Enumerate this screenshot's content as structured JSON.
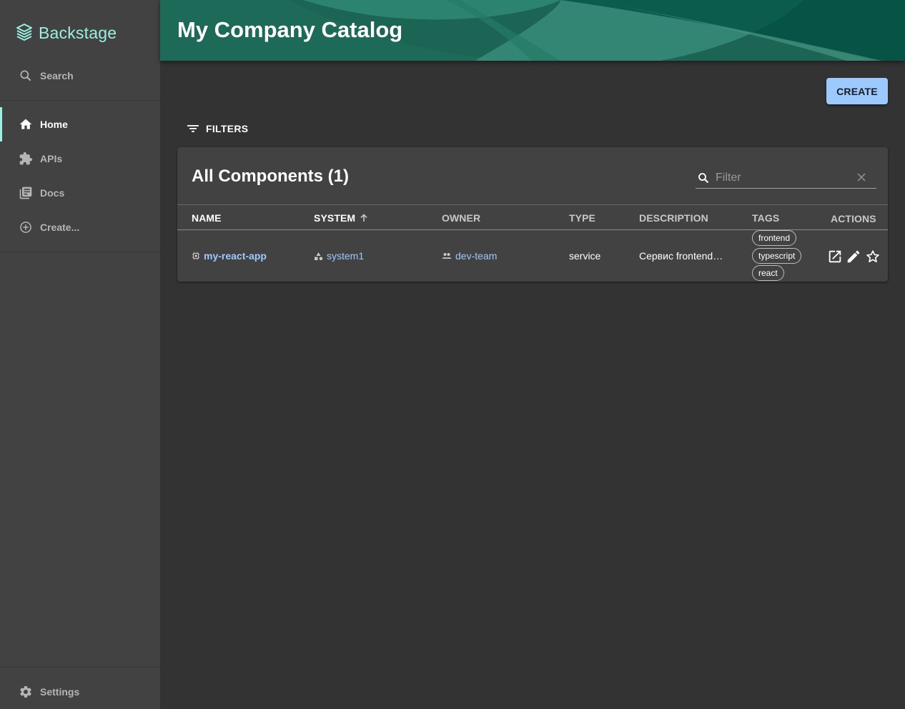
{
  "sidebar": {
    "logo_text": "Backstage",
    "search_label": "Search",
    "items": [
      {
        "label": "Home",
        "icon": "home-icon",
        "active": true
      },
      {
        "label": "APIs",
        "icon": "puzzle-icon",
        "active": false
      },
      {
        "label": "Docs",
        "icon": "docs-icon",
        "active": false
      },
      {
        "label": "Create...",
        "icon": "add-circle-icon",
        "active": false
      }
    ],
    "settings_label": "Settings"
  },
  "header": {
    "title": "My Company Catalog"
  },
  "toolbar": {
    "create_label": "CREATE",
    "filters_label": "FILTERS"
  },
  "table": {
    "title": "All Components (1)",
    "search_placeholder": "Filter",
    "columns": [
      "NAME",
      "SYSTEM",
      "OWNER",
      "TYPE",
      "DESCRIPTION",
      "TAGS",
      "ACTIONS"
    ],
    "rows": [
      {
        "name": "my-react-app",
        "system": "system1",
        "owner": "dev-team",
        "type": "service",
        "description": "Сервис frontend…",
        "tags": [
          "frontend",
          "typescript",
          "react"
        ]
      }
    ]
  },
  "colors": {
    "accent": "#9BF0E1",
    "link": "#9CC9FF",
    "sidebar_bg": "#424242",
    "page_bg": "#333333",
    "header_bg": "#1f6b5b"
  }
}
